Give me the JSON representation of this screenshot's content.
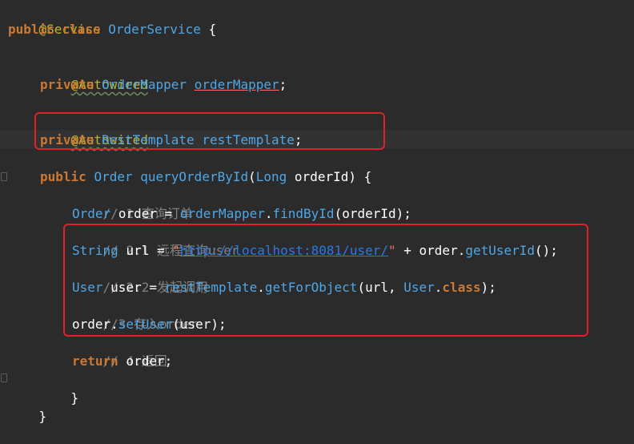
{
  "code": {
    "l1_annotation": "@Service",
    "l2_kw1": "public",
    "l2_kw2": "class",
    "l2_name": "OrderService",
    "l2_brace": "{",
    "l4_annotation": "@Autowired",
    "l5_kw": "private",
    "l5_type": "OrderMapper",
    "l5_field": "orderMapper",
    "l5_semi": ";",
    "l7_annotation": "@Autowired",
    "l8_kw": "private",
    "l8_type": "RestTemplate",
    "l8_field": "restTemplate",
    "l8_semi": ";",
    "l10_kw": "public",
    "l10_type": "Order",
    "l10_method": "queryOrderById",
    "l10_paren_open": "(",
    "l10_ptype": "Long",
    "l10_param": "orderId",
    "l10_tail": ") {",
    "l11_comment": "// 1.查询订单",
    "l12_type": "Order",
    "l12_var": "order =",
    "l12_field": "orderMapper",
    "l12_dot": ".",
    "l12_call": "findById",
    "l12_args": "(orderId);",
    "l13_comment": "// 2.1 远程查询user",
    "l14_type": "String",
    "l14_var": "url =",
    "l14_quote_open": "\"",
    "l14_url": "http://localhost:8081/user/",
    "l14_quote_close": "\"",
    "l14_plus": "+ order.",
    "l14_call": "getUserId",
    "l14_tail": "();",
    "l15_comment": "// 2.2 发起调用",
    "l16_type": "User",
    "l16_var": "user =",
    "l16_field": "restTemplate",
    "l16_dot": ".",
    "l16_call": "getForObject",
    "l16_args1": "(url,",
    "l16_cls": "User",
    "l16_dot2": ".",
    "l16_kw": "class",
    "l16_tail": ");",
    "l17_comment": "//3 存入order",
    "l18_obj": "order.",
    "l18_call": "setUser",
    "l18_args": "(user);",
    "l19_comment": "// 4.返回",
    "l20_kw": "return",
    "l20_val": "order;",
    "l21_brace": "}",
    "l22_brace": "}"
  },
  "colors": {
    "background": "#2b2b2b",
    "keyword": "#cc7832",
    "annotation": "#bbb529",
    "identifier": "#4fa6e6",
    "comment": "#808080",
    "string": "#e8735a",
    "url": "#287bde",
    "highlight_box": "#e0212a"
  }
}
